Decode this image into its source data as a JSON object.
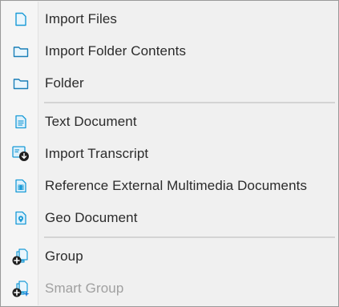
{
  "menu": {
    "items": [
      {
        "label": "Import Files",
        "icon": "file-icon"
      },
      {
        "label": "Import Folder Contents",
        "icon": "folder-icon"
      },
      {
        "label": "Folder",
        "icon": "folder-icon"
      },
      {
        "label": "Text Document",
        "icon": "text-document-icon"
      },
      {
        "label": "Import Transcript",
        "icon": "transcript-import-icon"
      },
      {
        "label": "Reference External Multimedia Documents",
        "icon": "multimedia-document-icon"
      },
      {
        "label": "Geo Document",
        "icon": "geo-document-icon"
      },
      {
        "label": "Group",
        "icon": "group-add-icon"
      },
      {
        "label": "Smart Group",
        "icon": "smart-group-add-icon",
        "disabled": true
      }
    ]
  },
  "colors": {
    "accent": "#1a9bd7",
    "menu_background": "#f0f0f0",
    "separator": "#d4d4d4",
    "text": "#2b2b2b",
    "disabled_text": "#a0a0a0"
  }
}
